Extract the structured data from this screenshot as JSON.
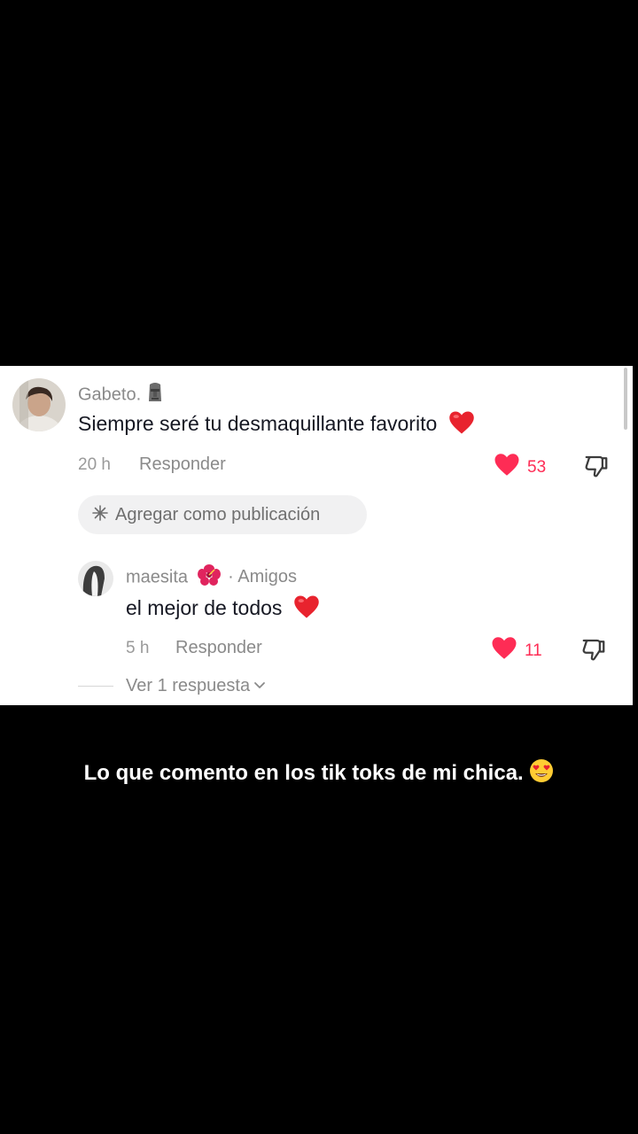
{
  "comment": {
    "username": "Gabeto.",
    "username_emoji": "moai-icon",
    "text": "Siempre seré tu desmaquillante favorito",
    "text_emoji": "red-heart-icon",
    "time": "20 h",
    "reply_label": "Responder",
    "like_count": "53"
  },
  "add_as_post": {
    "label": "Agregar como publicación",
    "icon": "sparkle-icon"
  },
  "reply": {
    "username": "maesita",
    "username_emoji": "hibiscus-icon",
    "relation": "· Amigos",
    "text": "el mejor de todos",
    "text_emoji": "red-heart-icon",
    "time": "5 h",
    "reply_label": "Responder",
    "like_count": "11"
  },
  "view_replies": {
    "label": "Ver 1 respuesta"
  },
  "caption": {
    "text": "Lo que comento en los tik toks de mi chica.",
    "emoji": "heart-eyes-icon"
  },
  "colors": {
    "like": "#fe2c55",
    "background": "#000000",
    "card": "#ffffff"
  }
}
